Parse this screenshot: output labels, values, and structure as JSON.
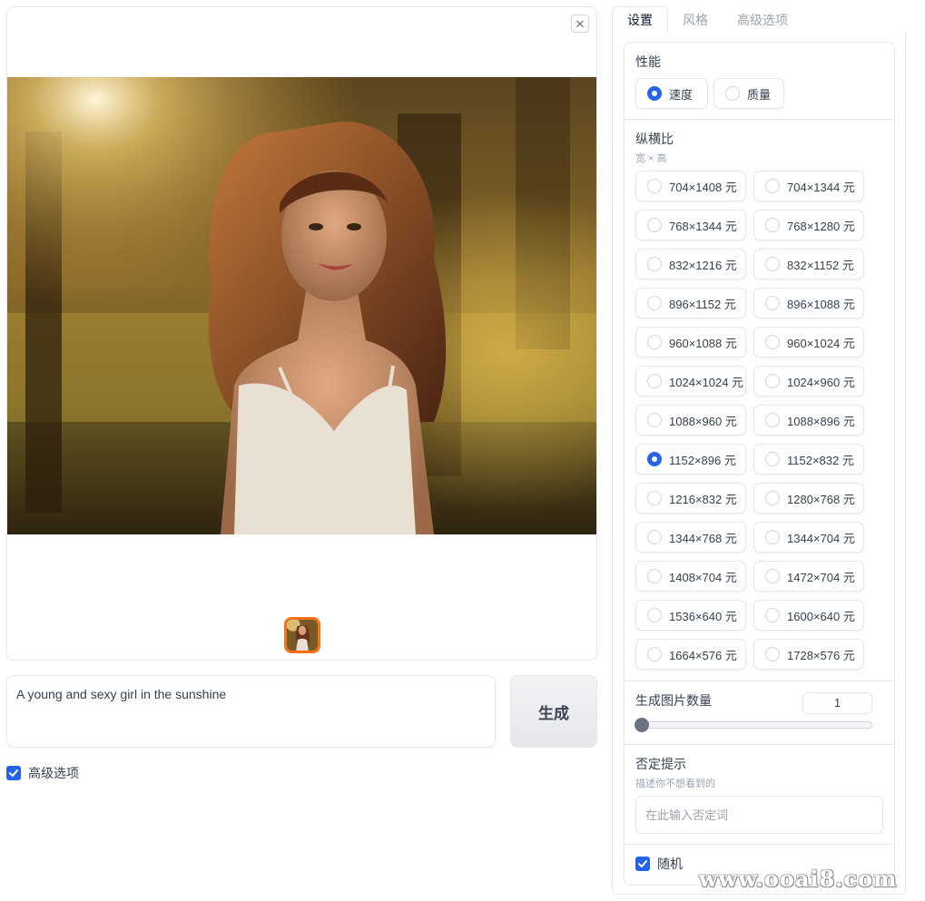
{
  "tabs": [
    "设置",
    "风格",
    "高级选项"
  ],
  "prompt": {
    "value": "A young and sexy girl in the sunshine"
  },
  "generate_label": "生成",
  "advanced_checkbox": {
    "label": "高级选项",
    "checked": true
  },
  "performance": {
    "title": "性能",
    "options": [
      {
        "label": "速度",
        "checked": true
      },
      {
        "label": "质量",
        "checked": false
      }
    ]
  },
  "aspect_ratio": {
    "title": "纵横比",
    "subtitle": "宽 × 高",
    "options": [
      {
        "label": "704×1408 元",
        "checked": false
      },
      {
        "label": "704×1344 元",
        "checked": false
      },
      {
        "label": "768×1344 元",
        "checked": false
      },
      {
        "label": "768×1280 元",
        "checked": false
      },
      {
        "label": "832×1216 元",
        "checked": false
      },
      {
        "label": "832×1152 元",
        "checked": false
      },
      {
        "label": "896×1152 元",
        "checked": false
      },
      {
        "label": "896×1088 元",
        "checked": false
      },
      {
        "label": "960×1088 元",
        "checked": false
      },
      {
        "label": "960×1024 元",
        "checked": false
      },
      {
        "label": "1024×1024 元",
        "checked": false
      },
      {
        "label": "1024×960 元",
        "checked": false
      },
      {
        "label": "1088×960 元",
        "checked": false
      },
      {
        "label": "1088×896 元",
        "checked": false
      },
      {
        "label": "1152×896 元",
        "checked": true
      },
      {
        "label": "1152×832 元",
        "checked": false
      },
      {
        "label": "1216×832 元",
        "checked": false
      },
      {
        "label": "1280×768 元",
        "checked": false
      },
      {
        "label": "1344×768 元",
        "checked": false
      },
      {
        "label": "1344×704 元",
        "checked": false
      },
      {
        "label": "1408×704 元",
        "checked": false
      },
      {
        "label": "1472×704 元",
        "checked": false
      },
      {
        "label": "1536×640 元",
        "checked": false
      },
      {
        "label": "1600×640 元",
        "checked": false
      },
      {
        "label": "1664×576 元",
        "checked": false
      },
      {
        "label": "1728×576 元",
        "checked": false
      }
    ]
  },
  "image_count": {
    "title": "生成图片数量",
    "value": "1"
  },
  "negative_prompt": {
    "title": "否定提示",
    "subtitle": "描述你不想看到的",
    "placeholder": "在此输入否定词"
  },
  "random_checkbox": {
    "label": "随机",
    "checked": true
  },
  "colors": {
    "accent": "#2563eb",
    "thumb_border": "#f97316"
  },
  "watermark": "www.ooai8.com"
}
